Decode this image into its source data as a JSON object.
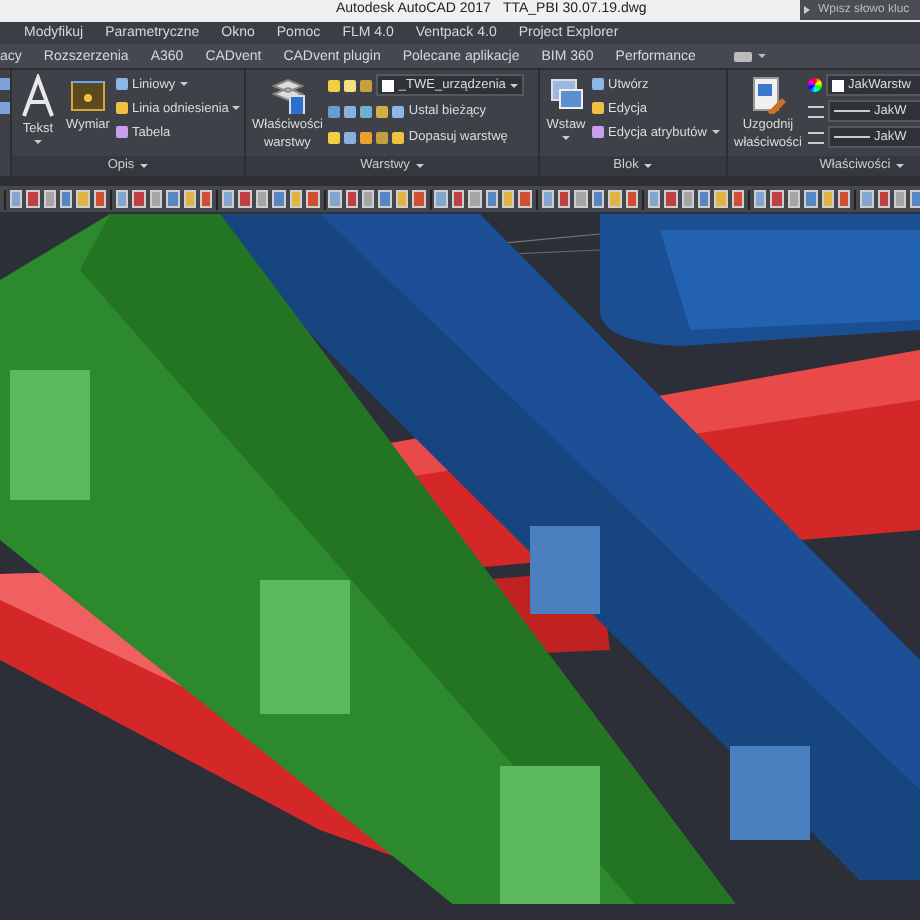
{
  "window": {
    "title": "Autodesk AutoCAD 2017",
    "file": "TTA_PBI 30.07.19.dwg"
  },
  "search": {
    "placeholder": "Wpisz słowo kluc"
  },
  "menu": [
    "Modyfikuj",
    "Parametryczne",
    "Okno",
    "Pomoc",
    "FLM 4.0",
    "Ventpack 4.0",
    "Project Explorer"
  ],
  "ribbon_tabs": [
    "acy",
    "Rozszerzenia",
    "A360",
    "CADvent",
    "CADvent plugin",
    "Polecane aplikacje",
    "BIM 360",
    "Performance"
  ],
  "panels": [
    {
      "kind": "annotation",
      "title": "Opis",
      "large": [
        {
          "label": "Tekst",
          "caret": true
        },
        {
          "label": "Wymiar",
          "caret": false
        }
      ],
      "small": [
        {
          "label": "Liniowy",
          "caret": true
        },
        {
          "label": "Linia odniesienia",
          "caret": true
        },
        {
          "label": "Tabela",
          "caret": false
        }
      ]
    },
    {
      "kind": "layers",
      "title": "Warstwy",
      "large": [
        {
          "label": "Właściwości warstwy",
          "caret": false
        }
      ],
      "layer": "_TWE_urządzenia",
      "small": [
        {
          "label": "Ustal bieżący",
          "caret": false
        },
        {
          "label": "Dopasuj warstwę",
          "caret": false
        }
      ]
    },
    {
      "kind": "block",
      "title": "Blok",
      "large": [
        {
          "label": "Wstaw",
          "caret": true
        }
      ],
      "small": [
        {
          "label": "Utwórz",
          "caret": false
        },
        {
          "label": "Edycja",
          "caret": false
        },
        {
          "label": "Edycja atrybutów",
          "caret": true
        }
      ]
    },
    {
      "kind": "properties",
      "title": "Właściwości",
      "large": [
        {
          "label": "Uzgodnij właściwości",
          "caret": false
        }
      ],
      "dropdowns": [
        "JakWarstw",
        "JakW",
        "JakW"
      ]
    }
  ]
}
